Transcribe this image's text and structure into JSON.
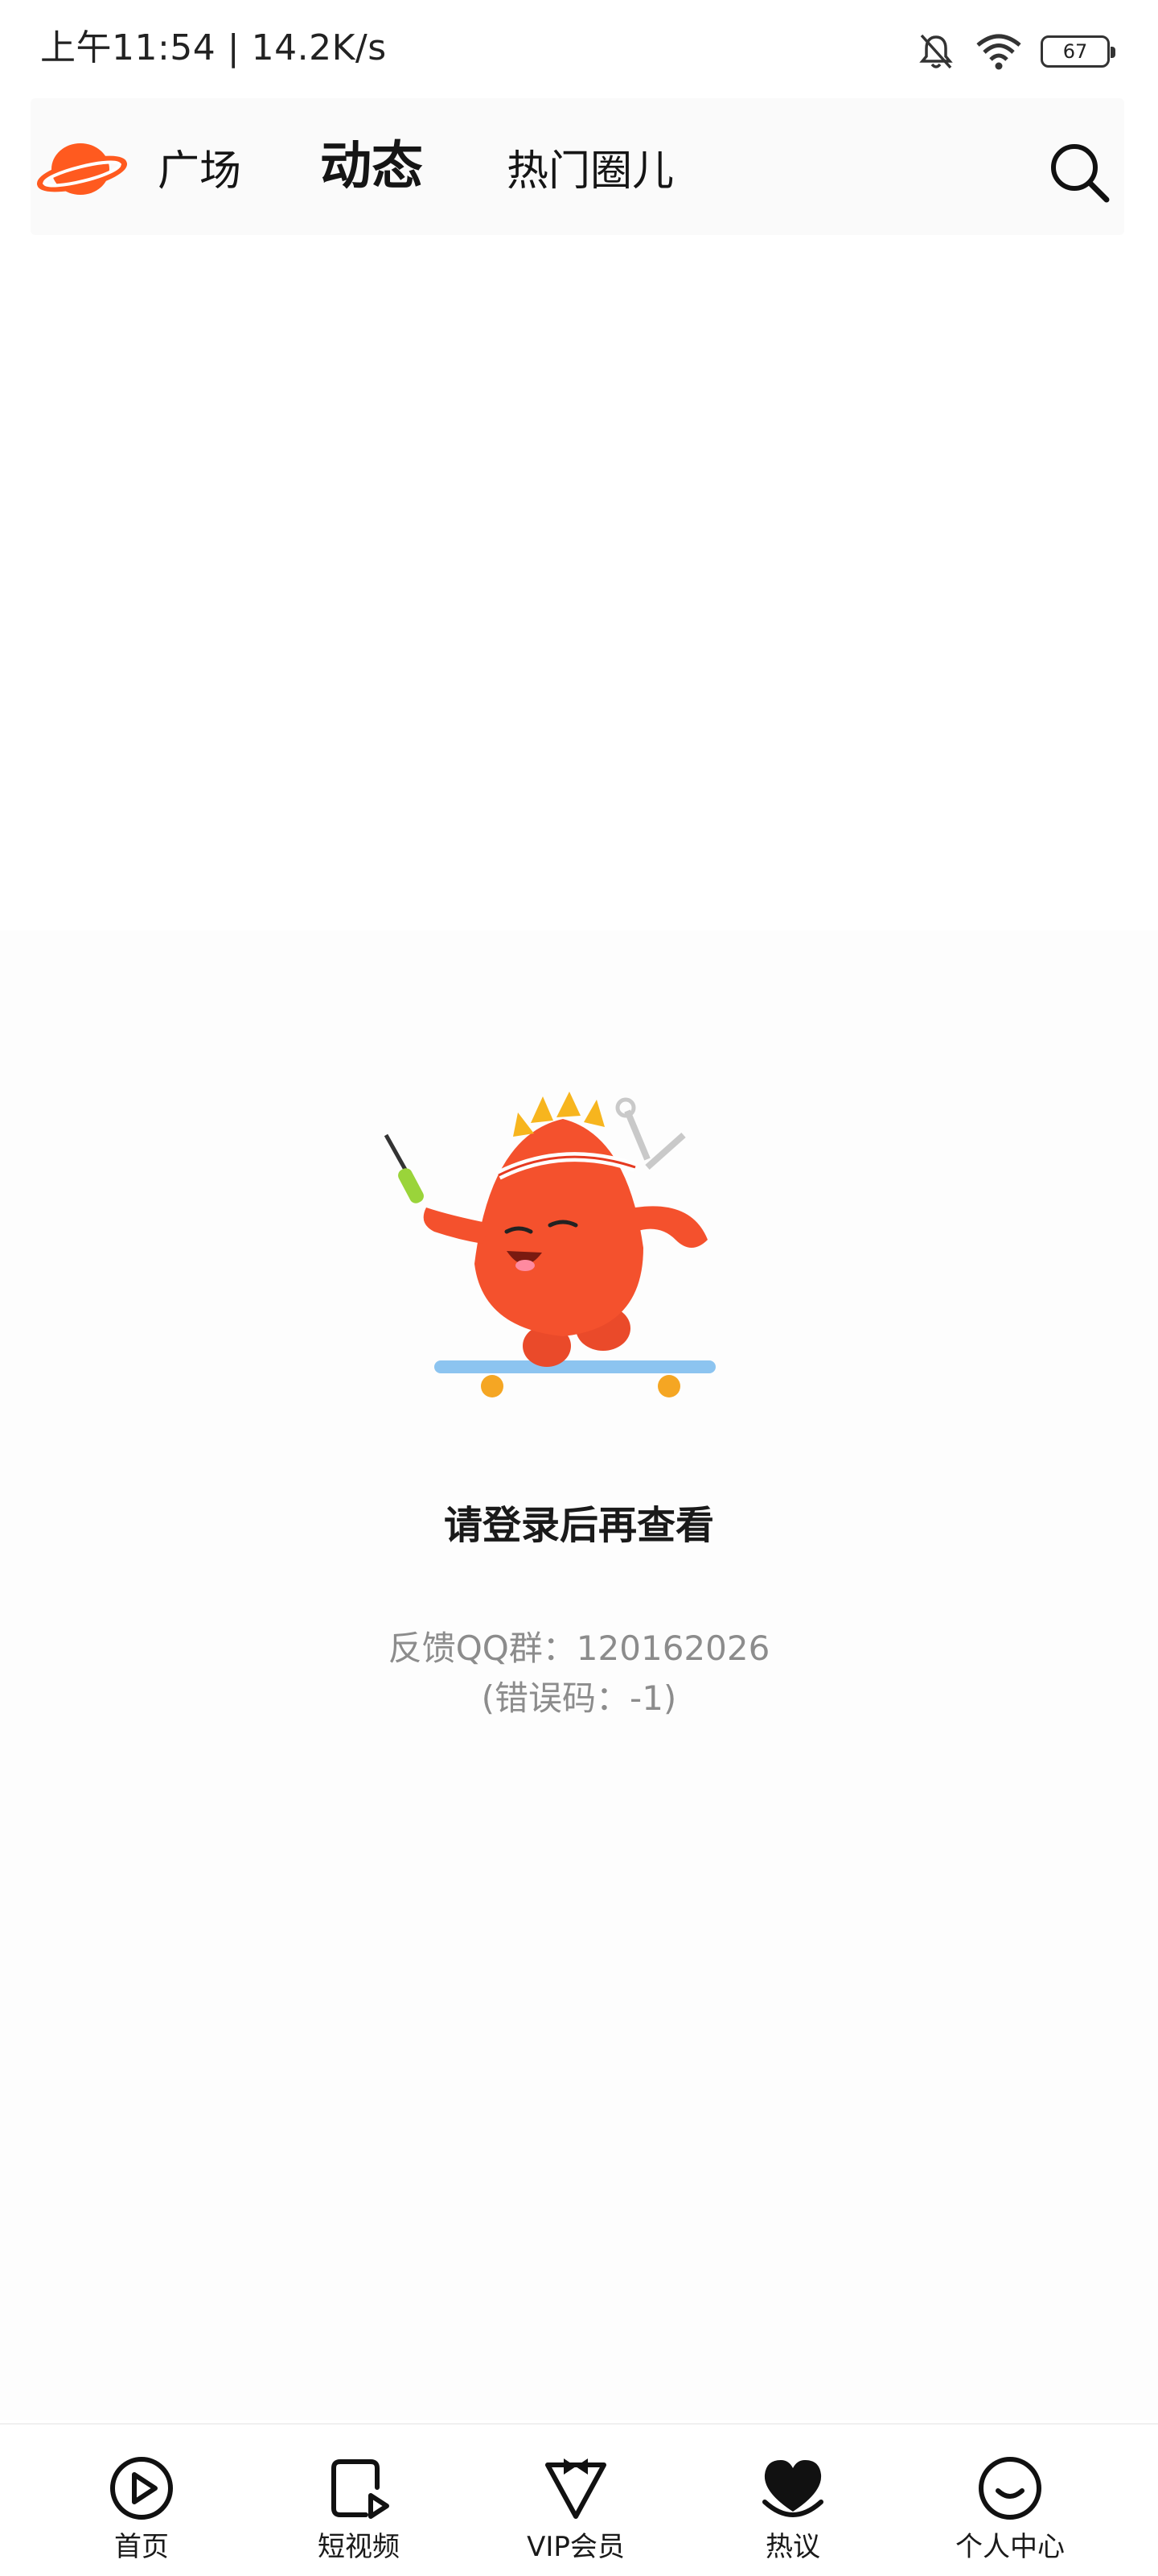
{
  "status_bar": {
    "time_speed": "上午11:54 | 14.2K/s",
    "battery": "67"
  },
  "top_nav": {
    "tabs": [
      {
        "label": "广场"
      },
      {
        "label": "动态"
      },
      {
        "label": "热门圈儿"
      }
    ],
    "active_tab": "动态"
  },
  "content": {
    "title": "请登录后再查看",
    "feedback": "反馈QQ群：120162026",
    "error_code": "(错误码：-1)"
  },
  "bottom_nav": {
    "items": [
      {
        "label": "首页",
        "icon": "play-circle-icon"
      },
      {
        "label": "短视频",
        "icon": "short-video-icon"
      },
      {
        "label": "VIP会员",
        "icon": "vip-bowtie-icon"
      },
      {
        "label": "热议",
        "icon": "heart-chat-icon"
      },
      {
        "label": "个人中心",
        "icon": "smile-face-icon"
      }
    ]
  },
  "colors": {
    "brand": "#ff5a1f",
    "mascot": "#f4512d",
    "secondary_text": "#8c8c8c"
  }
}
